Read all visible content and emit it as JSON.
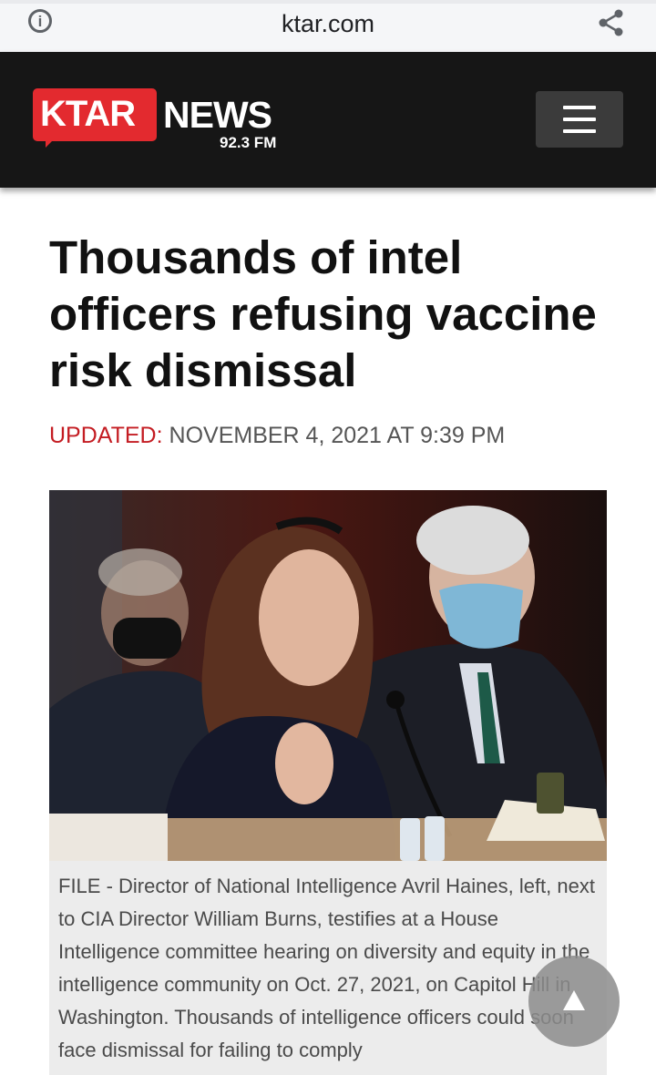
{
  "browser": {
    "url": "ktar.com",
    "info_icon": "info-icon",
    "share_icon": "share-icon"
  },
  "site": {
    "logo": {
      "primary": "KTAR",
      "secondary": "NEWS",
      "frequency": "92.3 FM"
    },
    "menu_icon": "hamburger-menu-icon",
    "colors": {
      "header_bg": "#161616",
      "brand_red": "#e32a2f"
    }
  },
  "article": {
    "headline": "Thousands of intel officers refusing vaccine risk dismissal",
    "updated_label": "UPDATED:",
    "updated_date": "NOVEMBER 4, 2021 AT 9:39 PM",
    "image_caption": "FILE - Director of National Intelligence Avril Haines, left, next to CIA Director William Burns, testifies at a House Intelligence committee hearing on diversity and equity in the intelligence community on Oct. 27, 2021, on Capitol Hill in Washington. Thousands of intelligence officers could soon face dismissal for failing to comply"
  },
  "scroll_top_icon": "arrow-up-icon"
}
